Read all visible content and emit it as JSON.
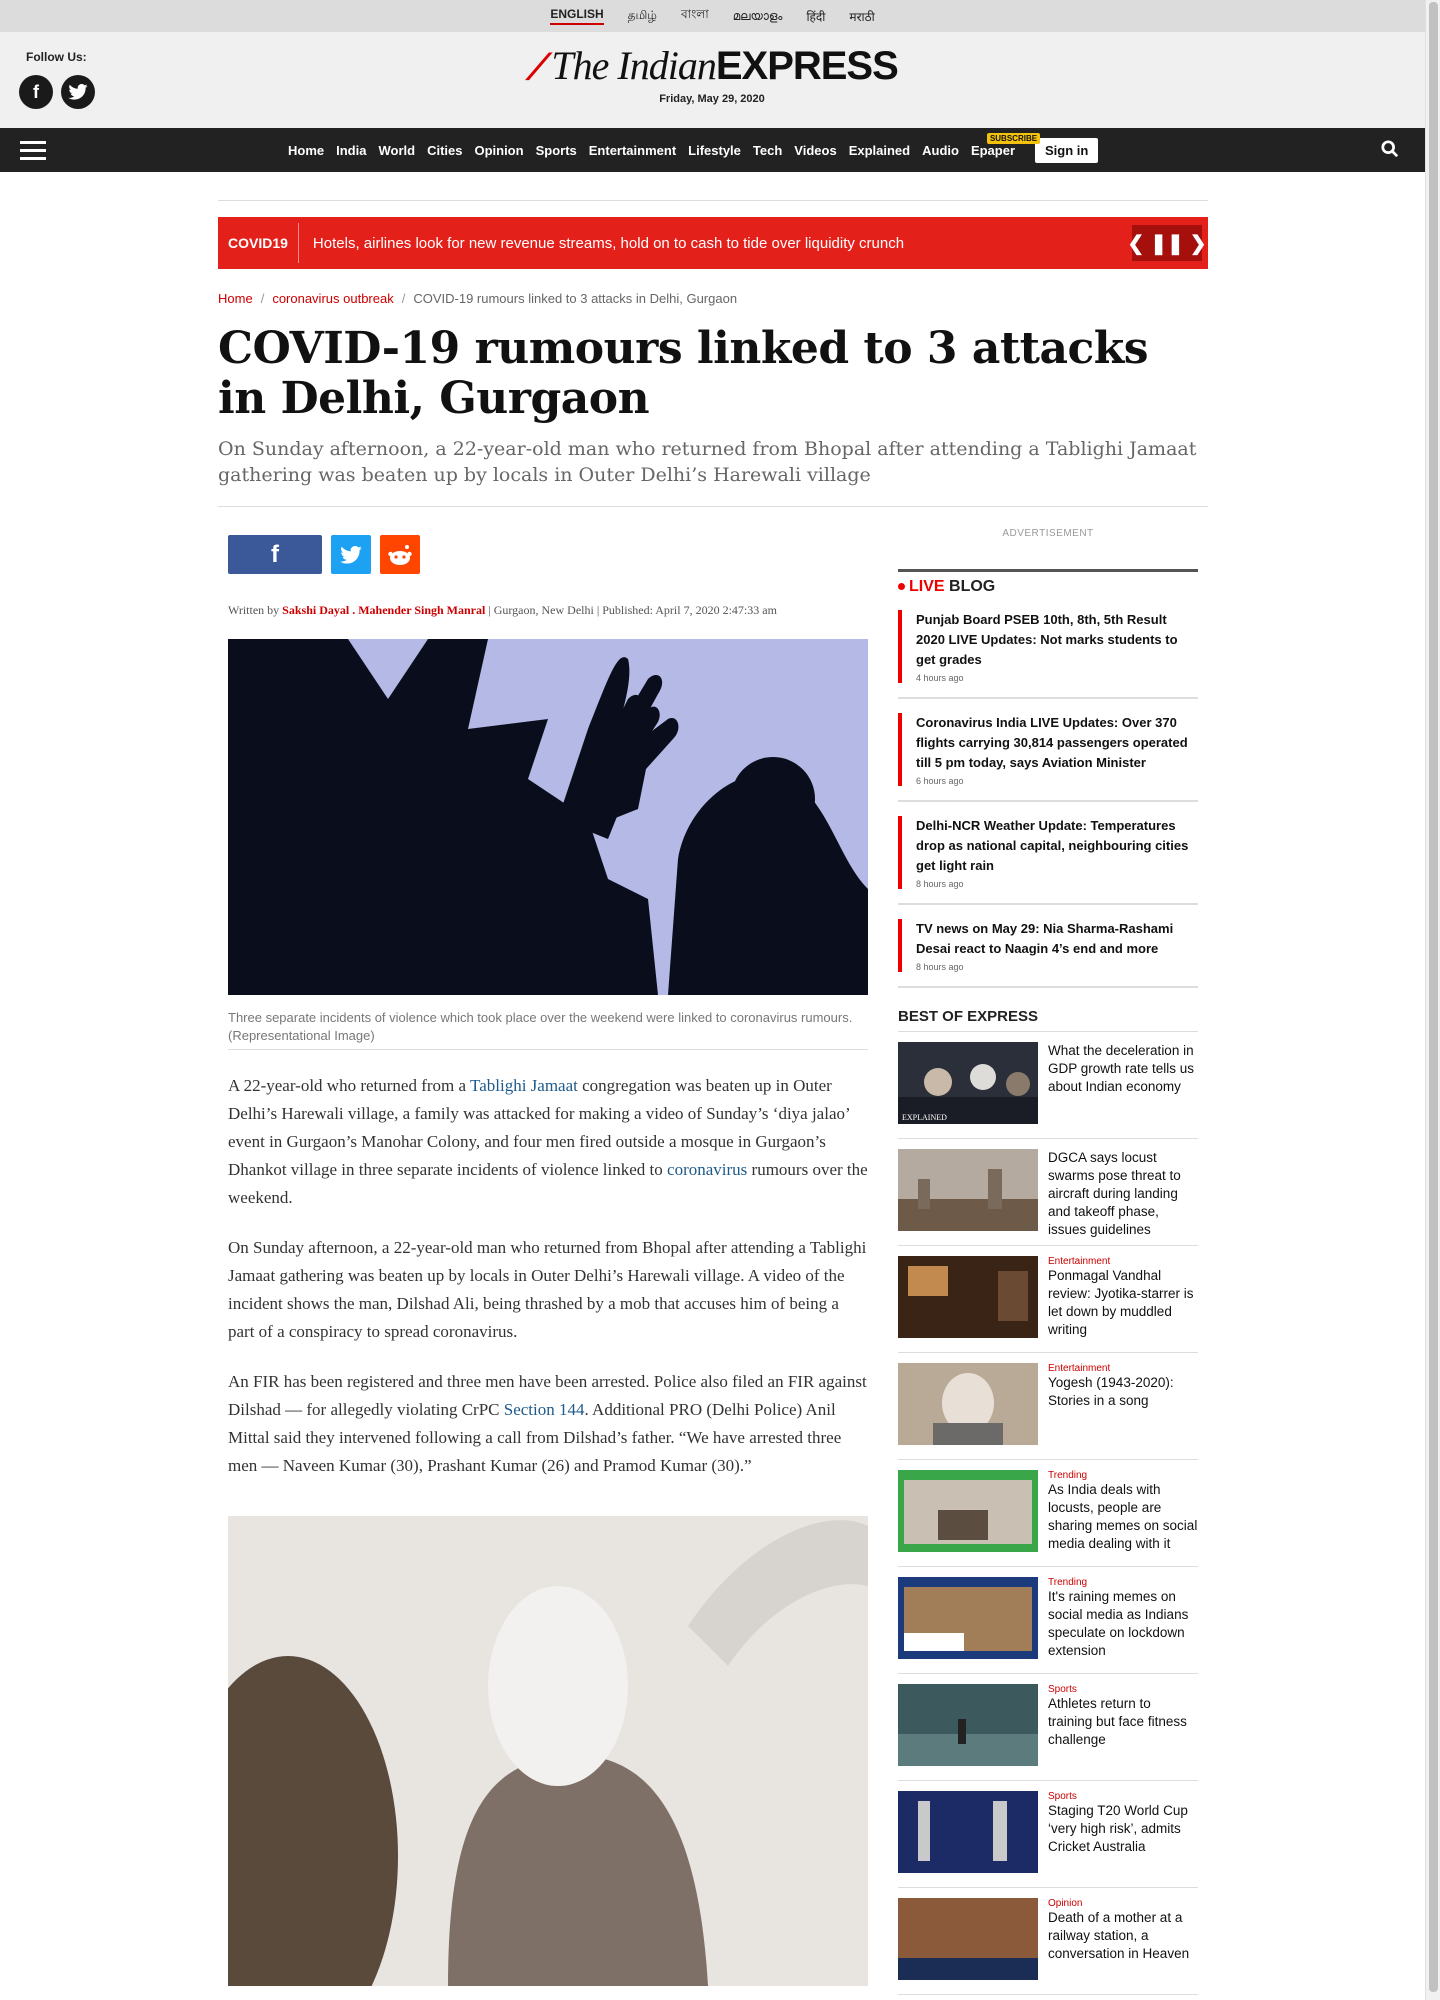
{
  "languages": [
    "ENGLISH",
    "தமிழ்",
    "বাংলা",
    "മലയാളം",
    "हिंदी",
    "मराठी"
  ],
  "masthead": {
    "follow_label": "Follow Us:",
    "brand_the_indian": "The Indian",
    "brand_express": "EXPRESS",
    "date": "Friday, May 29, 2020"
  },
  "nav": {
    "links": [
      "Home",
      "India",
      "World",
      "Cities",
      "Opinion",
      "Sports",
      "Entertainment",
      "Lifestyle",
      "Tech",
      "Videos",
      "Explained",
      "Audio"
    ],
    "epaper": "Epaper",
    "subscribe": "SUBSCRIBE",
    "signin": "Sign in"
  },
  "ticker": {
    "tag": "COVID19",
    "text": "Hotels, airlines look for new revenue streams, hold on to cash to tide over liquidity crunch"
  },
  "breadcrumb": {
    "home": "Home",
    "section": "coronavirus outbreak",
    "current": "COVID-19 rumours linked to 3 attacks in Delhi, Gurgaon"
  },
  "article": {
    "title": "COVID-19 rumours linked to 3 attacks in Delhi, Gurgaon",
    "standfirst": "On Sunday afternoon, a 22-year-old man who returned from Bhopal after attending a Tablighi Jamaat gathering was beaten up by locals in Outer Delhi’s Harewali village",
    "written_by": "Written by",
    "author1": "Sakshi Dayal",
    "author_sep": " . ",
    "author2": "Mahender Singh Manral",
    "location": "Gurgaon, New Delhi",
    "published": "Published: April 7, 2020 2:47:33 am",
    "caption": "Three separate incidents of violence which took place over the weekend were linked to coronavirus rumours. (Representational Image)",
    "p1_a": "A 22-year-old who returned from a ",
    "p1_link1": "Tablighi Jamaat",
    "p1_b": " congregation was beaten up in Outer Delhi’s Harewali village, a family was attacked for making a video of Sunday’s ‘diya jalao’ event in Gurgaon’s Manohar Colony, and four men fired outside a mosque in Gurgaon’s Dhankot village in three separate incidents of violence linked to ",
    "p1_link2": "coronavirus",
    "p1_c": " rumours over the weekend.",
    "p2": "On Sunday afternoon, a 22-year-old man who returned from Bhopal after attending a Tablighi Jamaat gathering was beaten up by locals in Outer Delhi’s Harewali village. A video of the incident shows the man, Dilshad Ali, being thrashed by a mob that accuses him of being a part of a conspiracy to spread coronavirus.",
    "p3_a": "An FIR has been registered and three men have been arrested. Police also filed an FIR against Dilshad — for allegedly violating CrPC ",
    "p3_link": "Section 144",
    "p3_b": ". Additional PRO (Delhi Police) Anil Mittal said they intervened following a call from Dilshad’s father. “We have arrested three men — Naveen Kumar (30), Prashant Kumar (26) and Pramod Kumar (30).”"
  },
  "sidebar": {
    "advertisement": "ADVERTISEMENT",
    "live_label": "LIVE",
    "blog_label": "BLOG",
    "live_items": [
      {
        "title": "Punjab Board PSEB 10th, 8th, 5th Result 2020 LIVE Updates: Not marks students to get grades",
        "ago": "4 hours ago"
      },
      {
        "title": "Coronavirus India LIVE Updates: Over 370 flights carrying 30,814 passengers operated till 5 pm today, says Aviation Minister",
        "ago": "6 hours ago"
      },
      {
        "title": "Delhi-NCR Weather Update: Temperatures drop as national capital, neighbouring cities get light rain",
        "ago": "8 hours ago"
      },
      {
        "title": "TV news on May 29: Nia Sharma-Rashami Desai react to Naagin 4’s end and more",
        "ago": "8 hours ago"
      }
    ],
    "best_heading": "BEST OF EXPRESS",
    "best_items": [
      {
        "category": "",
        "title": "What the deceleration in GDP growth rate tells us about Indian economy",
        "thumb_label": "EXPLAINED"
      },
      {
        "category": "",
        "title": "DGCA says locust swarms pose threat to aircraft during landing and takeoff phase, issues guidelines"
      },
      {
        "category": "Entertainment",
        "title": "Ponmagal Vandhal review: Jyotika-starrer is let down by muddled writing"
      },
      {
        "category": "Entertainment",
        "title": "Yogesh (1943-2020): Stories in a song"
      },
      {
        "category": "Trending",
        "title": "As India deals with locusts, people are sharing memes on social media dealing with it"
      },
      {
        "category": "Trending",
        "title": "It's raining memes on social media as Indians speculate on lockdown extension"
      },
      {
        "category": "Sports",
        "title": "Athletes return to training but face fitness challenge"
      },
      {
        "category": "Sports",
        "title": "Staging T20 World Cup ‘very high risk’, admits Cricket Australia"
      },
      {
        "category": "Opinion",
        "title": "Death of a mother at a railway station, a conversation in Heaven"
      }
    ]
  },
  "colors": {
    "accent": "#e4201b",
    "nav_bg": "#222222",
    "link": "#1d5a8a"
  }
}
